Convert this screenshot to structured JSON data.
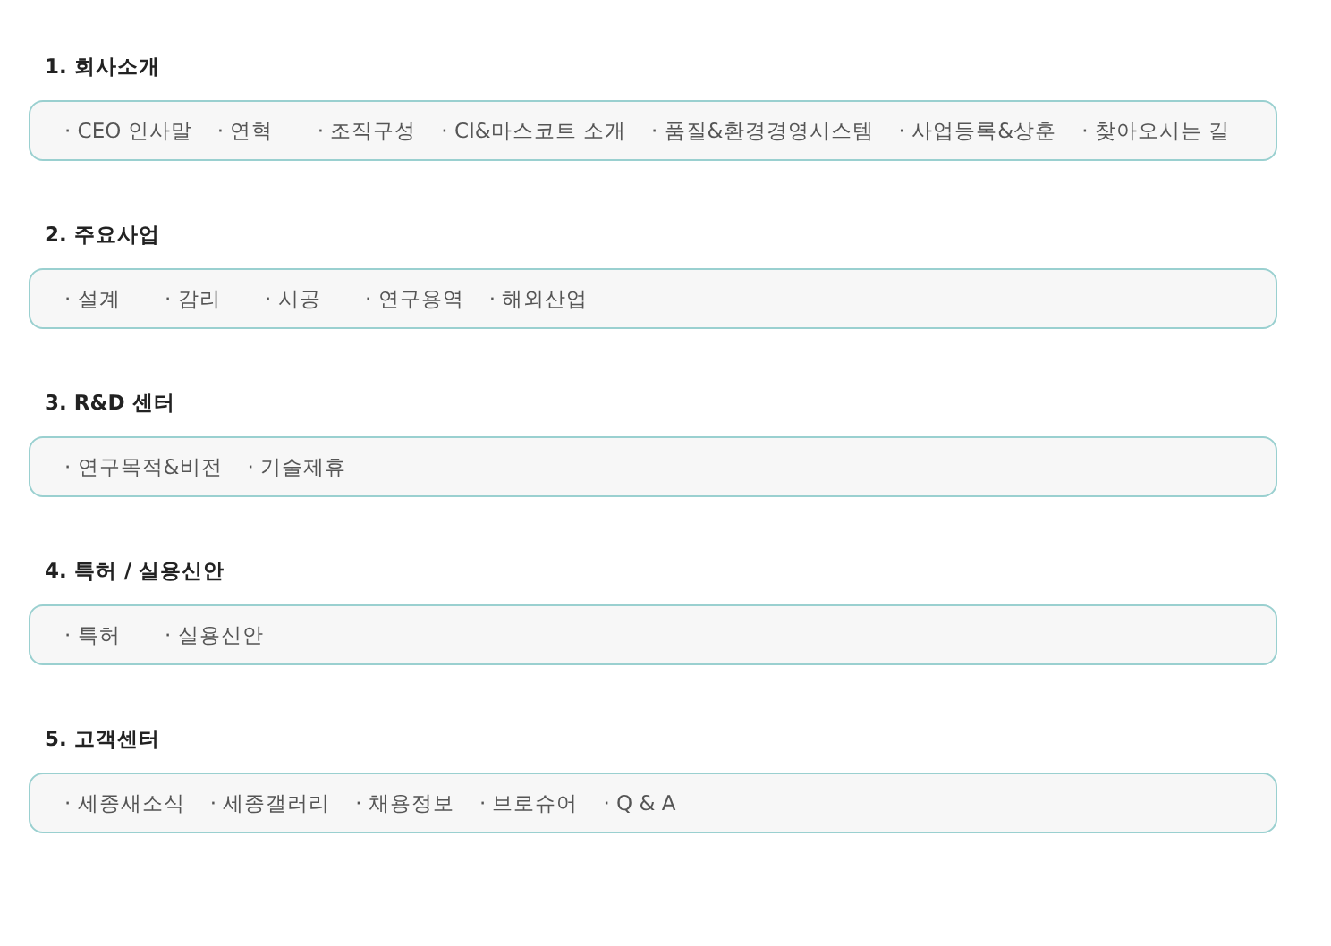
{
  "sections": [
    {
      "title": "1. 회사소개",
      "links": [
        "· CEO 인사말",
        "· 연혁",
        "· 조직구성",
        "· CI&마스코트 소개",
        "· 품질&환경경영시스템",
        "· 사업등록&상훈",
        "· 찾아오시는 길"
      ]
    },
    {
      "title": "2. 주요사업",
      "links": [
        "· 설계",
        "· 감리",
        "· 시공",
        "· 연구용역",
        "· 해외산업"
      ]
    },
    {
      "title": "3. R&D 센터",
      "links": [
        "· 연구목적&비전",
        "· 기술제휴"
      ]
    },
    {
      "title": "4. 특허 / 실용신안",
      "links": [
        "· 특허",
        "· 실용신안"
      ]
    },
    {
      "title": "5. 고객센터",
      "links": [
        "· 세종새소식",
        "· 세종갤러리",
        "· 채용정보",
        "· 브로슈어",
        "· Q & A"
      ]
    }
  ]
}
